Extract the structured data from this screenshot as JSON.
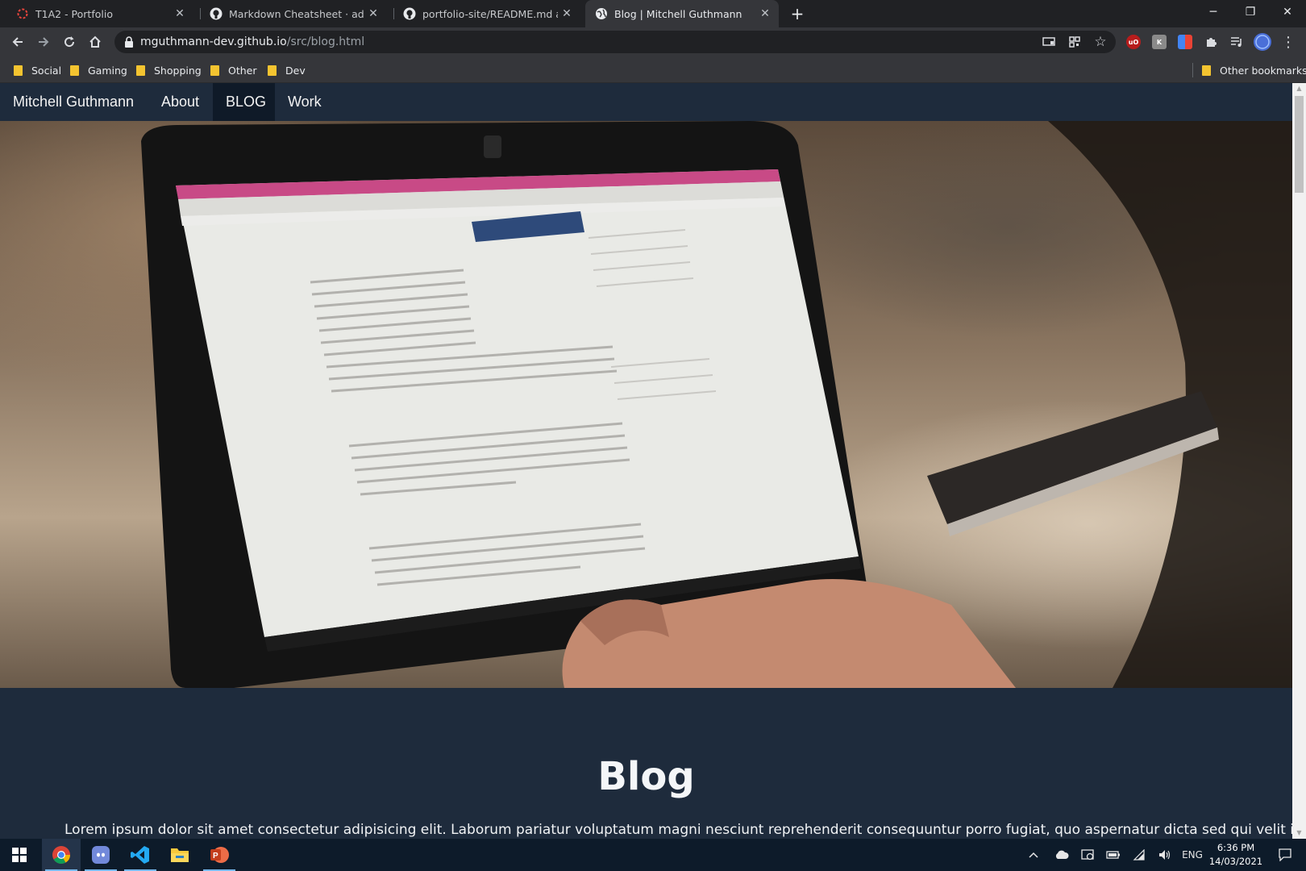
{
  "browser": {
    "tabs": [
      {
        "title": "T1A2 - Portfolio",
        "icon": "target-icon",
        "active": false
      },
      {
        "title": "Markdown Cheatsheet · adam-p/",
        "icon": "github-icon",
        "active": false
      },
      {
        "title": "portfolio-site/README.md at ma",
        "icon": "github-icon",
        "active": false
      },
      {
        "title": "Blog | Mitchell Guthmann",
        "icon": "globe-icon",
        "active": true
      }
    ],
    "new_tab_label": "+",
    "url_host": "mguthmann-dev.github.io",
    "url_path": "/src/blog.html",
    "bookmarks": [
      "Social",
      "Gaming",
      "Shopping",
      "Other",
      "Dev"
    ],
    "other_bookmarks": "Other bookmarks",
    "colors": {
      "tabstrip": "#202124",
      "toolbar": "#35363a",
      "folder": "#f4c430"
    }
  },
  "site": {
    "nav": {
      "brand": "Mitchell Guthmann",
      "about": "About",
      "blog": "BLOG",
      "work": "Work"
    },
    "hero_alt": "hero-laptop-image",
    "heading": "Blog",
    "intro": "Lorem ipsum dolor sit amet consectetur adipisicing elit. Laborum pariatur voluptatum magni nesciunt reprehenderit consequuntur porro fugiat, quo aspernatur dicta sed qui velit inventore",
    "colors": {
      "background": "#1e2b3c",
      "nav_active": "#0f1a28"
    }
  },
  "taskbar": {
    "apps": [
      "start-icon",
      "chrome-icon",
      "discord-icon",
      "vscode-icon",
      "file-explorer-icon",
      "powerpoint-icon"
    ],
    "language": "ENG",
    "time": "6:36 PM",
    "date": "14/03/2021"
  }
}
